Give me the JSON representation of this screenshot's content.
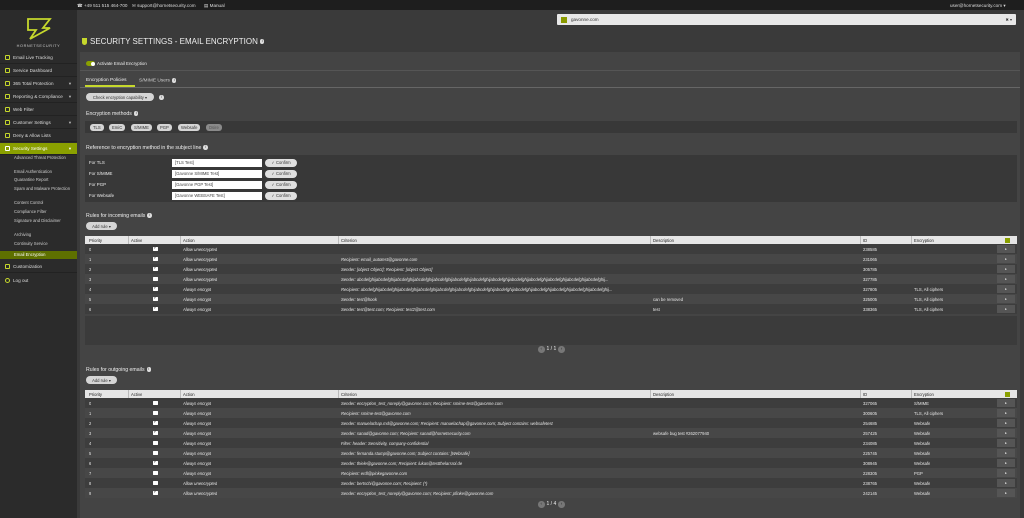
{
  "topbar": {
    "phone": "+49 511 515 464-700",
    "email": "support@hornetsecurity.com",
    "manual": "Manual",
    "user": "user@hornetsecurity.com"
  },
  "brand": {
    "name": "HORNETSECURITY",
    "accent": "#c6d82c"
  },
  "domain": {
    "value": "gavonne.com"
  },
  "page": {
    "title": "SECURITY SETTINGS - EMAIL ENCRYPTION"
  },
  "sidebar": {
    "items": [
      {
        "label": "Email Live Tracking",
        "icon": "search-icon"
      },
      {
        "label": "Service Dashboard",
        "icon": "dashboard-icon"
      },
      {
        "label": "365 Total Protection",
        "icon": "shield-icon"
      },
      {
        "label": "Reporting & Compliance",
        "icon": "chart-icon"
      },
      {
        "label": "Web Filter",
        "icon": "filter-icon"
      },
      {
        "label": "Customer Settings",
        "icon": "settings-icon"
      },
      {
        "label": "Deny & Allow Lists",
        "icon": "list-icon"
      },
      {
        "label": "Security Settings",
        "icon": "lock-icon"
      }
    ],
    "sub": [
      "Advanced Threat Protection",
      "Email Authentication",
      "Quarantine Report",
      "Spam and Malware Protection",
      "Content Control",
      "Compliance Filter",
      "Signature and Disclaimer",
      "Archiving",
      "Continuity Service",
      "Email Encryption"
    ],
    "bottom": [
      {
        "label": "Customization",
        "icon": "brush-icon"
      },
      {
        "label": "Log out",
        "icon": "power-icon"
      }
    ]
  },
  "activate_label": "Activate Email Encryption",
  "tabs": [
    "Encryption Policies",
    "S/MIME Users"
  ],
  "check_button": "Check encryption capability",
  "methods": {
    "title": "Encryption methods",
    "items": [
      "TLS",
      "EmiC",
      "S/MIME",
      "PGP",
      "Websafe",
      "Dsire"
    ]
  },
  "reference": {
    "title": "Reference to encryption method in the subject line",
    "confirm": "Confirm",
    "rows": [
      {
        "label": "For TLS",
        "value": "[TLS Test]"
      },
      {
        "label": "For S/MIME",
        "value": "[Gavonne S/MIME Test]"
      },
      {
        "label": "For PGP",
        "value": "[Gavonne PGP Test]"
      },
      {
        "label": "For Websafe",
        "value": "[Gavonne WEBSAFE Test]"
      }
    ]
  },
  "incoming": {
    "title": "Rules for incoming emails",
    "add": "Add rule",
    "headers": [
      "Priority",
      "Active",
      "Action",
      "Criterion",
      "Description",
      "ID",
      "Encryption"
    ],
    "rows": [
      {
        "p": "0",
        "a": true,
        "action": "Allow unencrypted",
        "crit": "",
        "desc": "",
        "id": "238585",
        "enc": ""
      },
      {
        "p": "1",
        "a": true,
        "action": "Allow unencrypted",
        "crit": "Recipient: email_autotest@gavonne.com",
        "desc": "",
        "id": "231065",
        "enc": ""
      },
      {
        "p": "2",
        "a": true,
        "action": "Allow unencrypted",
        "crit": "Sender: [object Object]; Recipient: [object Object]",
        "desc": "",
        "id": "305785",
        "enc": ""
      },
      {
        "p": "3",
        "a": false,
        "action": "Allow unencrypted",
        "crit": "Sender: abcdefghijabcdefghijabcdefghijabcdefghijabcdefghijabcdefghijabcdefghijabcdefghijabcdefghijabcdefghijabcdefghijabcdefghijabcdefghij...",
        "desc": "",
        "id": "327785",
        "enc": ""
      },
      {
        "p": "4",
        "a": true,
        "action": "Always encrypt",
        "crit": "Recipient: abcdefghijabcdefghijabcdefghijabcdefghijabcdefghijabcdefghijabcdefghijabcdefghijabcdefghijabcdefghijabcdefghijabcdefghijabcdefghij...",
        "desc": "",
        "id": "327805",
        "enc": "TLS, All ciphers"
      },
      {
        "p": "5",
        "a": true,
        "action": "Always encrypt",
        "crit": "Sender: test@hook",
        "desc": "can be removed",
        "id": "325005",
        "enc": "TLS, All ciphers"
      },
      {
        "p": "6",
        "a": true,
        "action": "Always encrypt",
        "crit": "Sender: test@test.com; Recipient: test2@test.com",
        "desc": "test",
        "id": "338365",
        "enc": "TLS, All ciphers"
      }
    ],
    "pager": "1 / 1"
  },
  "outgoing": {
    "title": "Rules for outgoing emails",
    "add": "Add rule",
    "headers": [
      "Priority",
      "Active",
      "Action",
      "Criterion",
      "Description",
      "ID",
      "Encryption"
    ],
    "rows": [
      {
        "p": "0",
        "a": false,
        "action": "Always encrypt",
        "crit": "Sender: encryption_test_noreply@gavonne.com; Recipient: smime-test@gavonne.com",
        "desc": "",
        "id": "327065",
        "enc": "S/MIME"
      },
      {
        "p": "1",
        "a": false,
        "action": "Always encrypt",
        "crit": "Recipient: smime-test@gavonne.com",
        "desc": "",
        "id": "300605",
        "enc": "TLS, All ciphers"
      },
      {
        "p": "2",
        "a": true,
        "action": "Always encrypt",
        "crit": "Sender: manuelachap.md@gavonne.com; Recipient: manuelachap@gavonne.com; Subject contains: websafetest",
        "desc": "",
        "id": "254685",
        "enc": "Websafe"
      },
      {
        "p": "3",
        "a": true,
        "action": "Always encrypt",
        "crit": "Sender: sanad@gavonne.com; Recipient: sanad@hornetsecurity.com",
        "desc": "websafe bug test #262077940",
        "id": "257425",
        "enc": "Websafe"
      },
      {
        "p": "4",
        "a": false,
        "action": "Always encrypt",
        "crit": "Filter: header: Sensitivity, company-confidential",
        "desc": "",
        "id": "234085",
        "enc": "Websafe"
      },
      {
        "p": "5",
        "a": false,
        "action": "Always encrypt",
        "crit": "Sender: fernanda.stump@gavonne.com; Subject contains: [Websafe]",
        "desc": "",
        "id": "225745",
        "enc": "Websafe"
      },
      {
        "p": "6",
        "a": true,
        "action": "Always encrypt",
        "crit": "Sender: thiele@gavonne.com; Recipient: lukas@testthelarsrol.de",
        "desc": "",
        "id": "308945",
        "enc": "Websafe"
      },
      {
        "p": "7",
        "a": false,
        "action": "Always encrypt",
        "crit": "Recipient: erdl@pinkegavonne.com",
        "desc": "",
        "id": "228305",
        "enc": "PGP"
      },
      {
        "p": "8",
        "a": false,
        "action": "Allow unencrypted",
        "crit": "Sender: bertschi@gavonne.com; Recipient: (*)",
        "desc": "",
        "id": "238765",
        "enc": "Websafe"
      },
      {
        "p": "9",
        "a": true,
        "action": "Allow unencrypted",
        "crit": "Sender: encryption_test_noreply@gavonne.com; Recipient: pfinke@gavonne.com",
        "desc": "",
        "id": "242145",
        "enc": "Websafe"
      }
    ],
    "pager": "1 / 4"
  }
}
